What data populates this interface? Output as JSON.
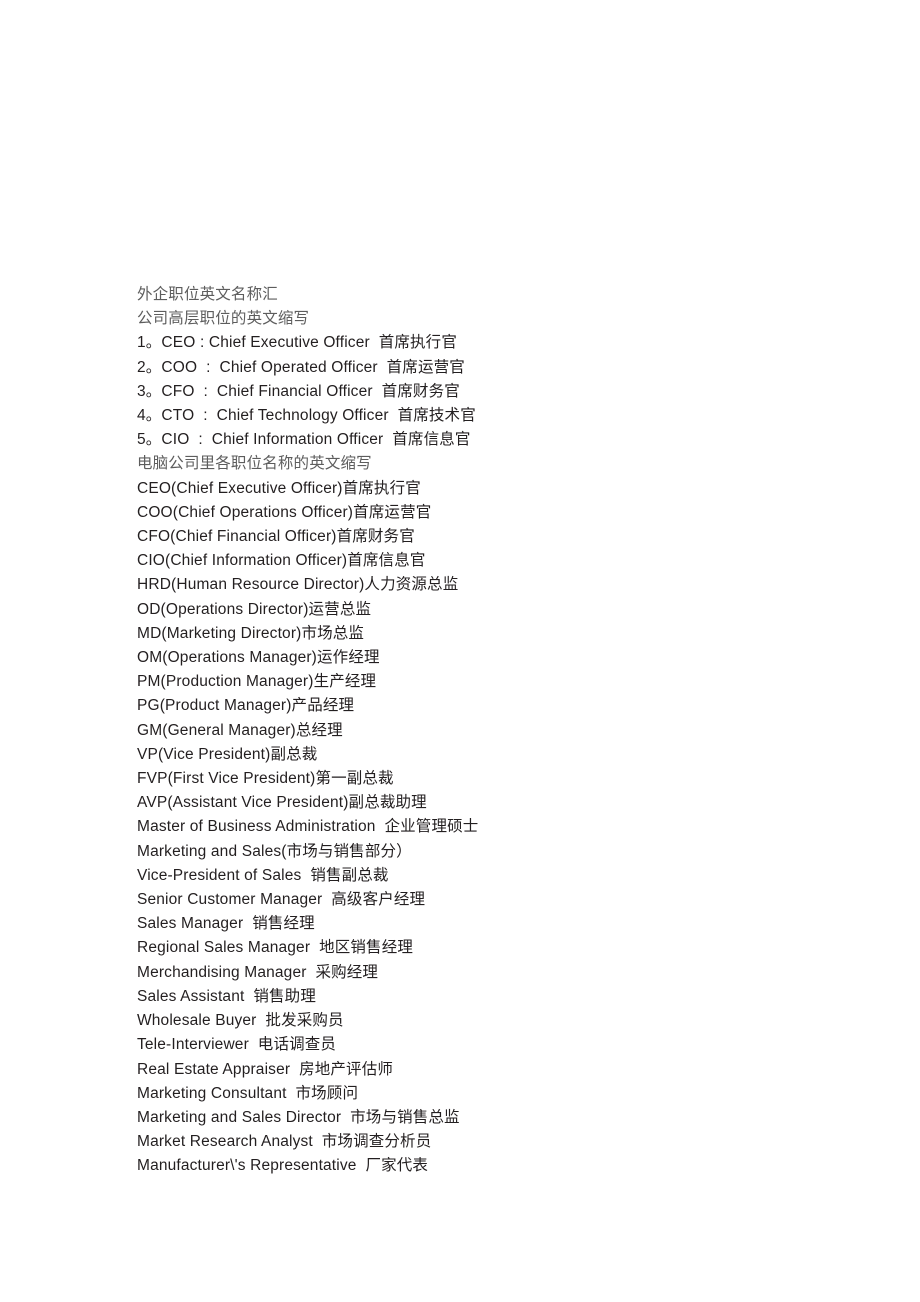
{
  "document": {
    "background_color": "#ffffff",
    "text_color": "#231f20",
    "heading_color": "#5d5d5d",
    "lines": [
      {
        "text": "外企职位英文名称汇",
        "style": "heading"
      },
      {
        "text": "公司高层职位的英文缩写",
        "style": "heading"
      },
      {
        "text": "1。CEO : Chief Executive Officer  首席执行官",
        "style": "body"
      },
      {
        "text": "2。COO  :  Chief Operated Officer  首席运营官",
        "style": "body"
      },
      {
        "text": "3。CFO  :  Chief Financial Officer  首席财务官",
        "style": "body"
      },
      {
        "text": "4。CTO  :  Chief Technology Officer  首席技术官",
        "style": "body"
      },
      {
        "text": "5。CIO  :  Chief Information Officer  首席信息官",
        "style": "body"
      },
      {
        "text": "电脑公司里各职位名称的英文缩写",
        "style": "heading"
      },
      {
        "text": "CEO(Chief Executive Officer)首席执行官",
        "style": "body"
      },
      {
        "text": "COO(Chief Operations Officer)首席运营官",
        "style": "body"
      },
      {
        "text": "CFO(Chief Financial Officer)首席财务官",
        "style": "body"
      },
      {
        "text": "CIO(Chief Information Officer)首席信息官",
        "style": "body"
      },
      {
        "text": "HRD(Human Resource Director)人力资源总监",
        "style": "body"
      },
      {
        "text": "OD(Operations Director)运营总监",
        "style": "body"
      },
      {
        "text": "MD(Marketing Director)市场总监",
        "style": "body"
      },
      {
        "text": "OM(Operations Manager)运作经理",
        "style": "body"
      },
      {
        "text": "PM(Production Manager)生产经理",
        "style": "body"
      },
      {
        "text": "PG(Product Manager)产品经理",
        "style": "body"
      },
      {
        "text": "GM(General Manager)总经理",
        "style": "body"
      },
      {
        "text": "VP(Vice President)副总裁",
        "style": "body"
      },
      {
        "text": "FVP(First Vice President)第一副总裁",
        "style": "body"
      },
      {
        "text": "AVP(Assistant Vice President)副总裁助理",
        "style": "body"
      },
      {
        "text": "Master of Business Administration  企业管理硕士",
        "style": "body"
      },
      {
        "text": "Marketing and Sales(市场与销售部分）",
        "style": "body"
      },
      {
        "text": "Vice-President of Sales  销售副总裁",
        "style": "body"
      },
      {
        "text": "Senior Customer Manager  高级客户经理",
        "style": "body"
      },
      {
        "text": "Sales Manager  销售经理",
        "style": "body"
      },
      {
        "text": "Regional Sales Manager  地区销售经理",
        "style": "body"
      },
      {
        "text": "Merchandising Manager  采购经理",
        "style": "body"
      },
      {
        "text": "Sales Assistant  销售助理",
        "style": "body"
      },
      {
        "text": "Wholesale Buyer  批发采购员",
        "style": "body"
      },
      {
        "text": "Tele-Interviewer  电话调查员",
        "style": "body"
      },
      {
        "text": "Real Estate Appraiser  房地产评估师",
        "style": "body"
      },
      {
        "text": "Marketing Consultant  市场顾问",
        "style": "body"
      },
      {
        "text": "Marketing and Sales Director  市场与销售总监",
        "style": "body"
      },
      {
        "text": "Market Research Analyst  市场调查分析员",
        "style": "body"
      },
      {
        "text": "Manufacturer\\'s Representative  厂家代表",
        "style": "body"
      }
    ]
  }
}
